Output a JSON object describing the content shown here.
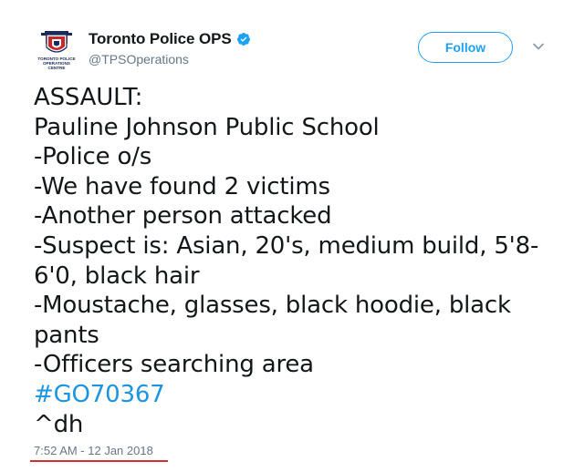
{
  "author": {
    "display_name": "Toronto Police OPS",
    "handle": "@TPSOperations",
    "verified": true,
    "avatar_text": [
      "TORONTO POLICE",
      "OPERATIONS",
      "CENTRE"
    ]
  },
  "follow_button": {
    "label": "Follow"
  },
  "tweet": {
    "lines": [
      "ASSAULT:",
      "Pauline Johnson Public School",
      "-Police o/s",
      "-We have found 2 victims",
      "-Another person attacked",
      "-Suspect is: Asian, 20's, medium build, 5'8-6'0, black hair",
      "-Moustache, glasses, black hoodie, black pants",
      "-Officers searching area"
    ],
    "hashtag": "#GO70367",
    "signature": "^dh"
  },
  "timestamp": "7:52 AM - 12 Jan 2018",
  "colors": {
    "accent": "#1da1f2",
    "hashtag": "#1b95e0",
    "muted": "#657786",
    "annotation_underline": "#d32f2f"
  }
}
